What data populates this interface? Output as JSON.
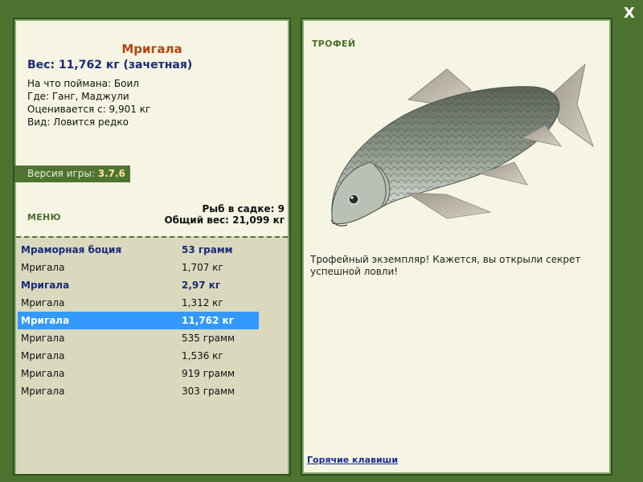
{
  "close_label": "X",
  "fish": {
    "title": "Мригала",
    "weight_line": "Вес: 11,762 кг (зачетная)",
    "bait": "На что поймана: Боил",
    "location": "Где: Ганг, Маджули",
    "value": "Оценивается с: 9,901 кг",
    "rarity": "Вид: Ловится редко"
  },
  "version": {
    "label": "Версия игры:",
    "value": "3.7.6"
  },
  "menu_label": "МЕНЮ",
  "keepnet": {
    "count_text": "Рыб в садке: 9",
    "total_text": "Общий вес: 21,099 кг"
  },
  "fish_list": {
    "selected_index": 4,
    "rows": [
      {
        "name": "Мраморная боция",
        "weight": "53 грамм",
        "bold": true
      },
      {
        "name": "Мригала",
        "weight": "1,707 кг",
        "bold": false
      },
      {
        "name": "Мригала",
        "weight": "2,97 кг",
        "bold": true
      },
      {
        "name": "Мригала",
        "weight": "1,312 кг",
        "bold": false
      },
      {
        "name": "Мригала",
        "weight": "11,762 кг",
        "bold": true
      },
      {
        "name": "Мригала",
        "weight": "535 грамм",
        "bold": false
      },
      {
        "name": "Мригала",
        "weight": "1,536 кг",
        "bold": false
      },
      {
        "name": "Мригала",
        "weight": "919 грамм",
        "bold": false
      },
      {
        "name": "Мригала",
        "weight": "303 грамм",
        "bold": false
      }
    ]
  },
  "trophy": {
    "label": "ТРОФЕЙ",
    "message": "Трофейный экземпляр! Кажется, вы открыли секрет успешной ловли!"
  },
  "hotkeys_label": "Горячие клавиши",
  "colors": {
    "background": "#4d7330",
    "panel": "#f6f5e3",
    "title": "#b44414",
    "weight": "#1a2a78",
    "selected_row": "#3399ff",
    "list_bg": "#dad9be"
  }
}
